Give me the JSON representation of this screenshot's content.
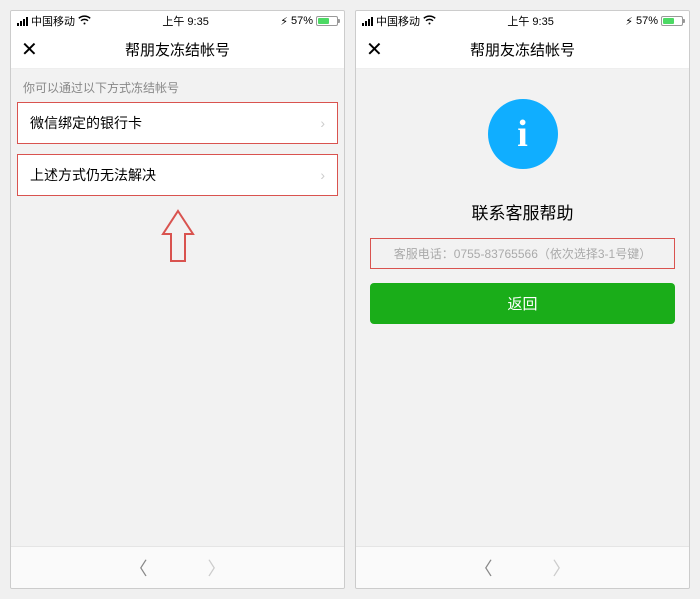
{
  "status": {
    "carrier": "中国移动",
    "time": "上午 9:35",
    "battery_text": "57%"
  },
  "nav": {
    "title": "帮朋友冻结帐号"
  },
  "screen1": {
    "hint": "你可以通过以下方式冻结帐号",
    "item1": "微信绑定的银行卡",
    "item2": "上述方式仍无法解决"
  },
  "screen2": {
    "headline": "联系客服帮助",
    "phone_line": "客服电话：0755-83765566（依次选择3-1号键）",
    "back_btn": "返回"
  }
}
